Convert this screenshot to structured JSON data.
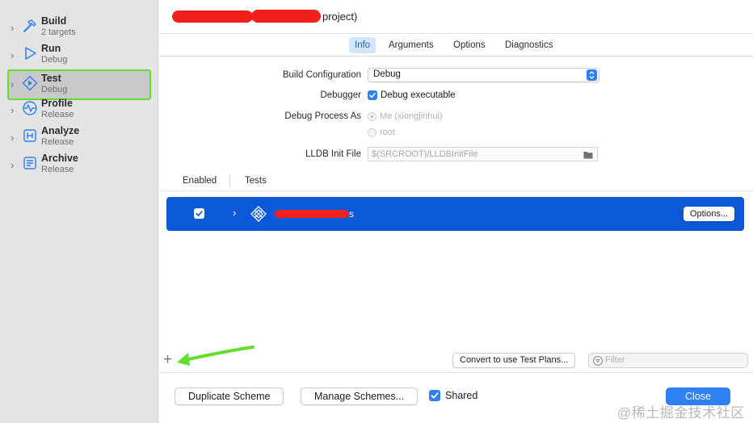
{
  "sidebar": {
    "items": [
      {
        "name": "Build",
        "sub": "2 targets",
        "icon": "hammer-icon"
      },
      {
        "name": "Run",
        "sub": "Debug",
        "icon": "play-icon"
      },
      {
        "name": "Test",
        "sub": "Debug",
        "icon": "test-diamond-icon",
        "selected": true
      },
      {
        "name": "Profile",
        "sub": "Release",
        "icon": "profile-wave-icon"
      },
      {
        "name": "Analyze",
        "sub": "Release",
        "icon": "analyze-icon"
      },
      {
        "name": "Archive",
        "sub": "Release",
        "icon": "archive-icon"
      }
    ]
  },
  "header": {
    "title_suffix": "project)"
  },
  "tabs": [
    {
      "label": "Info",
      "active": true
    },
    {
      "label": "Arguments"
    },
    {
      "label": "Options"
    },
    {
      "label": "Diagnostics"
    }
  ],
  "form": {
    "build_config_label": "Build Configuration",
    "build_config_value": "Debug",
    "debugger_label": "Debugger",
    "debugger_checkbox_label": "Debug executable",
    "debug_process_label": "Debug Process As",
    "radio_me": "Me (xiongjinhui)",
    "radio_root": "root",
    "lldb_label": "LLDB Init File",
    "lldb_placeholder": "$(SRCROOT)/LLDBInitFile"
  },
  "tests_table": {
    "col_enabled": "Enabled",
    "col_tests": "Tests",
    "row_name_suffix": "s",
    "options_button": "Options..."
  },
  "bottom": {
    "add_label": "+",
    "convert_button": "Convert to use Test Plans...",
    "filter_placeholder": "Filter",
    "duplicate_button": "Duplicate Scheme",
    "manage_button": "Manage Schemes...",
    "shared_label": "Shared",
    "close_button": "Close"
  },
  "watermark": "@稀土掘金技术社区",
  "colors": {
    "accent": "#2f7ff5",
    "selected_row": "#0b58d8",
    "highlight_green": "#63de2f",
    "redaction": "#f0211c"
  }
}
